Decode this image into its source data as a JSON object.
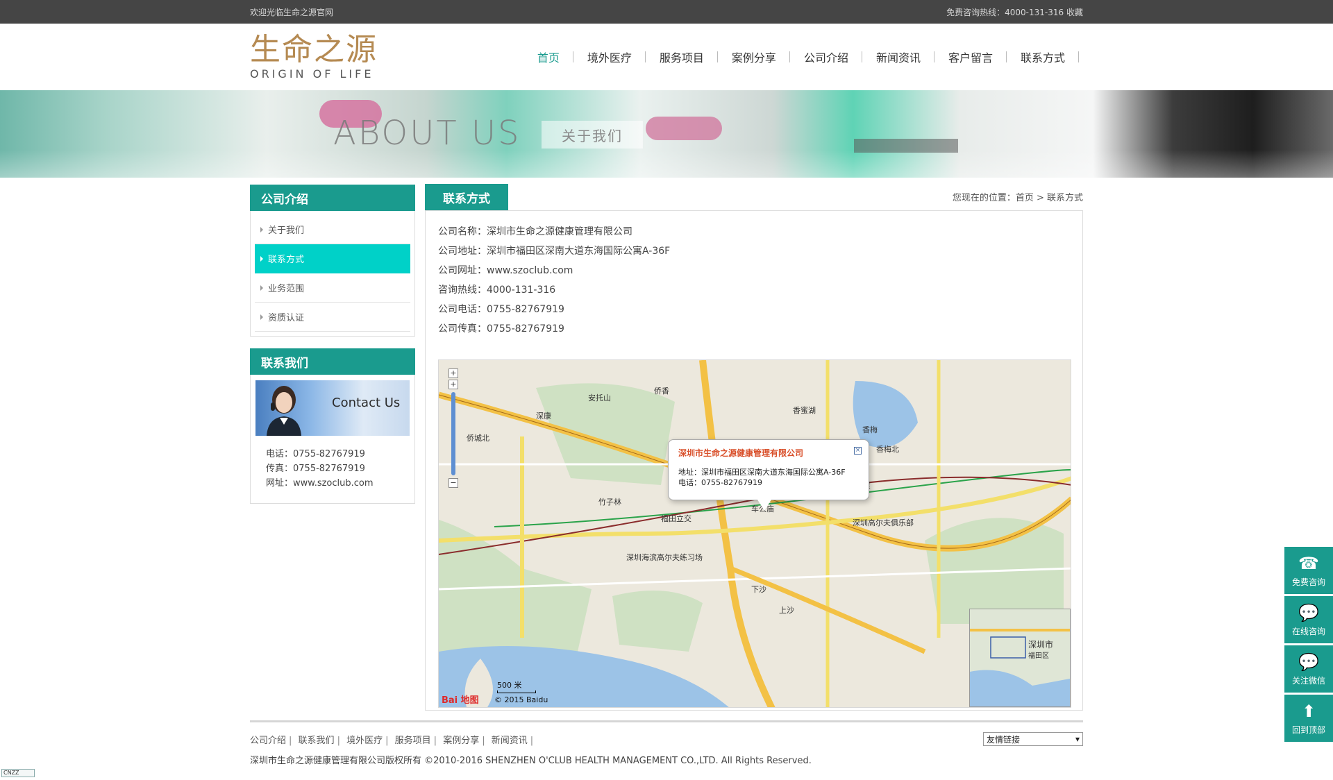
{
  "topbar": {
    "welcome": "欢迎光临生命之源官网",
    "hotline": "免费咨询热线：4000-131-316",
    "favorite": "收藏"
  },
  "logo": {
    "cn": "生命之源",
    "en": "ORIGIN OF LIFE"
  },
  "nav": [
    {
      "label": "首页",
      "active": true
    },
    {
      "label": "境外医疗"
    },
    {
      "label": "服务项目"
    },
    {
      "label": "案例分享"
    },
    {
      "label": "公司介绍"
    },
    {
      "label": "新闻资讯"
    },
    {
      "label": "客户留言"
    },
    {
      "label": "联系方式"
    }
  ],
  "banner": {
    "en": "ABOUT US",
    "cn": "关于我们"
  },
  "sidebar": {
    "about_title": "公司介绍",
    "items": [
      "关于我们",
      "联系方式",
      "业务范围",
      "资质认证"
    ],
    "contact_title": "联系我们",
    "contact_img_text": "Contact Us",
    "phone": "电话：0755-82767919",
    "fax": "传真：0755-82767919",
    "site": "网址：www.szoclub.com"
  },
  "content": {
    "tab": "联系方式",
    "breadcrumb": "您现在的位置：首页 > 联系方式",
    "lines": [
      "公司名称：深圳市生命之源健康管理有限公司",
      "公司地址：深圳市福田区深南大道东海国际公寓A-36F",
      "公司网址：www.szoclub.com",
      "咨询热线：4000-131-316",
      "公司电话：0755-82767919",
      "公司传真：0755-82767919"
    ]
  },
  "map": {
    "bubble_title": "深圳市生命之源健康管理有限公司",
    "bubble_addr": "地址：深圳市福田区深南大道东海国际公寓A-36F",
    "bubble_tel": "电话：0755-82767919",
    "scale": "500 米",
    "copyright": "© 2015 Baidu",
    "brand": "Bai 地图",
    "labels": [
      "侨香",
      "安托山",
      "深康",
      "侨城北",
      "香蜜湖",
      "竹子林",
      "车公庙",
      "下沙",
      "上沙",
      "香梅",
      "深圳高尔夫俱乐部",
      "深圳海滨高尔夫练习场",
      "福田立交",
      "香蜜",
      "蜜湖",
      "香梅北",
      "深圳市",
      "福田区"
    ]
  },
  "footer": {
    "links": [
      "公司介绍",
      "联系我们",
      "境外医疗",
      "服务项目",
      "案例分享",
      "新闻资讯"
    ],
    "friend_label": "友情链接",
    "copyright": "深圳市生命之源健康管理有限公司版权所有 ©2010-2016 SHENZHEN O'CLUB HEALTH MANAGEMENT CO.,LTD. All Rights Reserved."
  },
  "float": [
    "免费咨询",
    "在线咨询",
    "关注微信",
    "回到顶部"
  ],
  "cnzz": "CNZZ"
}
